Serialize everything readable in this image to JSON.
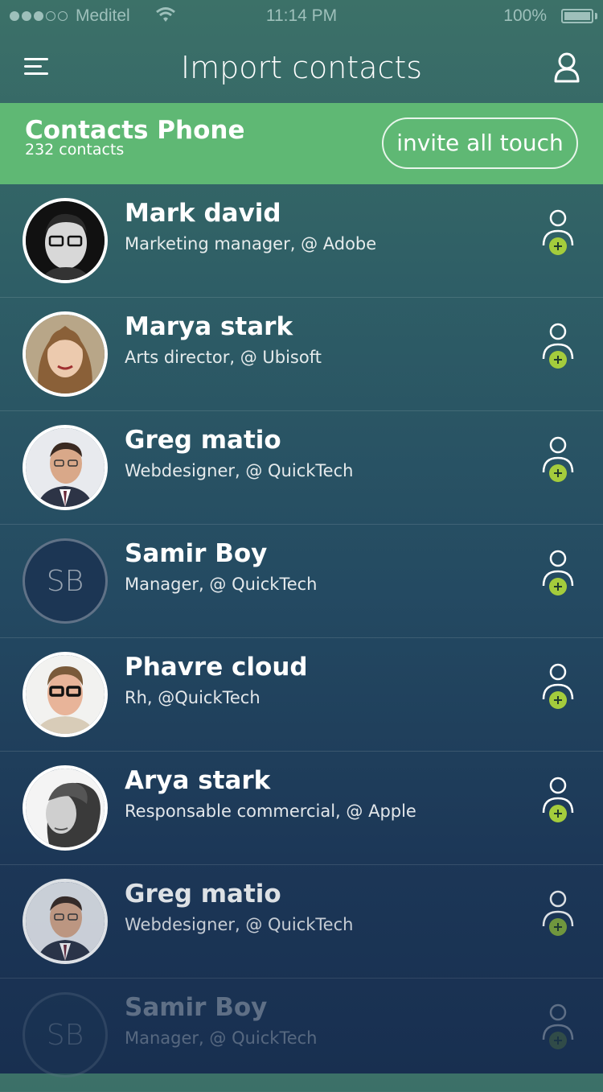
{
  "status_bar": {
    "carrier": "Meditel",
    "time": "11:14 PM",
    "battery": "100%"
  },
  "nav": {
    "title": "Import contacts"
  },
  "group": {
    "title": "Contacts Phone",
    "count": "232 contacts",
    "invite_label": "invite all touch"
  },
  "colors": {
    "accent_green": "#5fb874",
    "add_badge": "#a4cc3c"
  },
  "contacts": [
    {
      "name": "Mark david",
      "role": "Marketing manager, @ Adobe"
    },
    {
      "name": "Marya stark",
      "role": "Arts director, @ Ubisoft"
    },
    {
      "name": "Greg matio",
      "role": "Webdesigner, @ QuickTech"
    },
    {
      "name": "Samir Boy",
      "role": "Manager, @ QuickTech",
      "initials": "SB"
    },
    {
      "name": "Phavre cloud",
      "role": "Rh, @QuickTech"
    },
    {
      "name": "Arya stark",
      "role": "Responsable commercial, @ Apple"
    },
    {
      "name": "Greg matio",
      "role": "Webdesigner, @ QuickTech"
    },
    {
      "name": "Samir Boy",
      "role": "Manager, @ QuickTech",
      "initials": "SB"
    }
  ]
}
